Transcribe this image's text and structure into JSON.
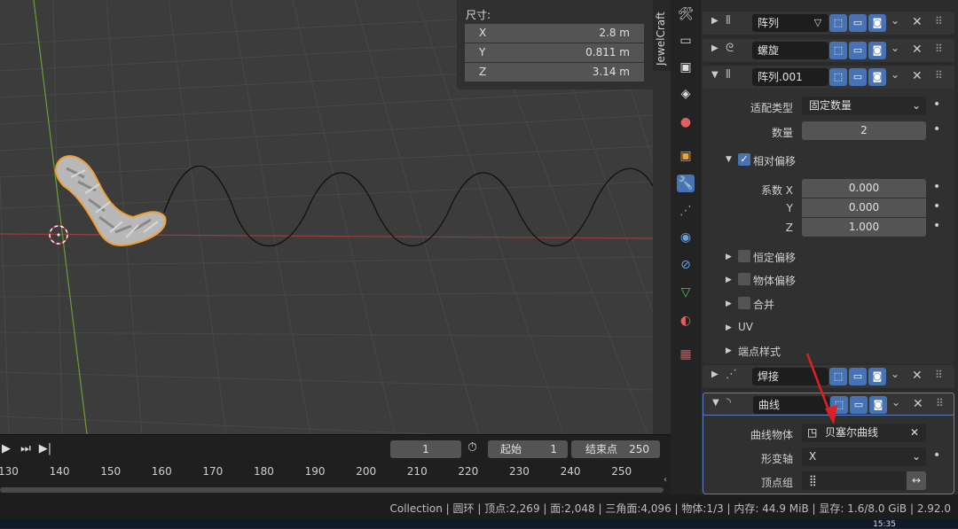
{
  "viewport": {
    "dimensions_title": "尺寸:",
    "dimensions": [
      {
        "axis": "X",
        "value": "2.8 m"
      },
      {
        "axis": "Y",
        "value": "0.811 m"
      },
      {
        "axis": "Z",
        "value": "3.14 m"
      }
    ],
    "n_panel_tab": "JewelCraft"
  },
  "timeline": {
    "current_frame": "1",
    "start_label": "起始",
    "start_value": "1",
    "end_label": "结束点",
    "end_value": "250",
    "ticks": [
      "130",
      "140",
      "150",
      "160",
      "170",
      "180",
      "190",
      "200",
      "210",
      "220",
      "230",
      "240",
      "250"
    ]
  },
  "status": {
    "text": "Collection | 圆环 | 顶点:2,269 | 面:2,048 | 三角面:4,096 | 物体:1/3 | 内存: 44.9 MiB | 显存: 1.6/8.0 GiB | 2.92.0",
    "clock": "15:35"
  },
  "sidebar_icons": [
    "tool-icon",
    "render-icon",
    "output-icon",
    "view-layer-icon",
    "scene-icon",
    "world-icon",
    "object-icon",
    "modifier-icon",
    "particles-icon",
    "physics-icon",
    "constraints-icon",
    "data-icon",
    "material-icon",
    "texture-icon"
  ],
  "modifiers": {
    "array1": {
      "name": "阵列"
    },
    "screw": {
      "name": "螺旋"
    },
    "array2": {
      "name": "阵列.001",
      "fit_type_label": "适配类型",
      "fit_type_value": "固定数量",
      "count_label": "数量",
      "count_value": "2",
      "relative_offset_label": "相对偏移",
      "factor_x_label": "系数 X",
      "factor_x": "0.000",
      "y_label": "Y",
      "factor_y": "0.000",
      "z_label": "Z",
      "factor_z": "1.000",
      "constant_offset_label": "恒定偏移",
      "object_offset_label": "物体偏移",
      "merge_label": "合并",
      "uv_label": "UV",
      "caps_label": "端点样式"
    },
    "weld": {
      "name": "焊接"
    },
    "curve": {
      "name": "曲线",
      "curve_object_label": "曲线物体",
      "curve_object_value": "贝塞尔曲线",
      "deform_axis_label": "形变轴",
      "deform_axis_value": "X",
      "vertex_group_label": "顶点组"
    }
  },
  "colors": {
    "accent": "#4772b3",
    "selection": "#f0a030",
    "red_arrow": "#e02020"
  }
}
